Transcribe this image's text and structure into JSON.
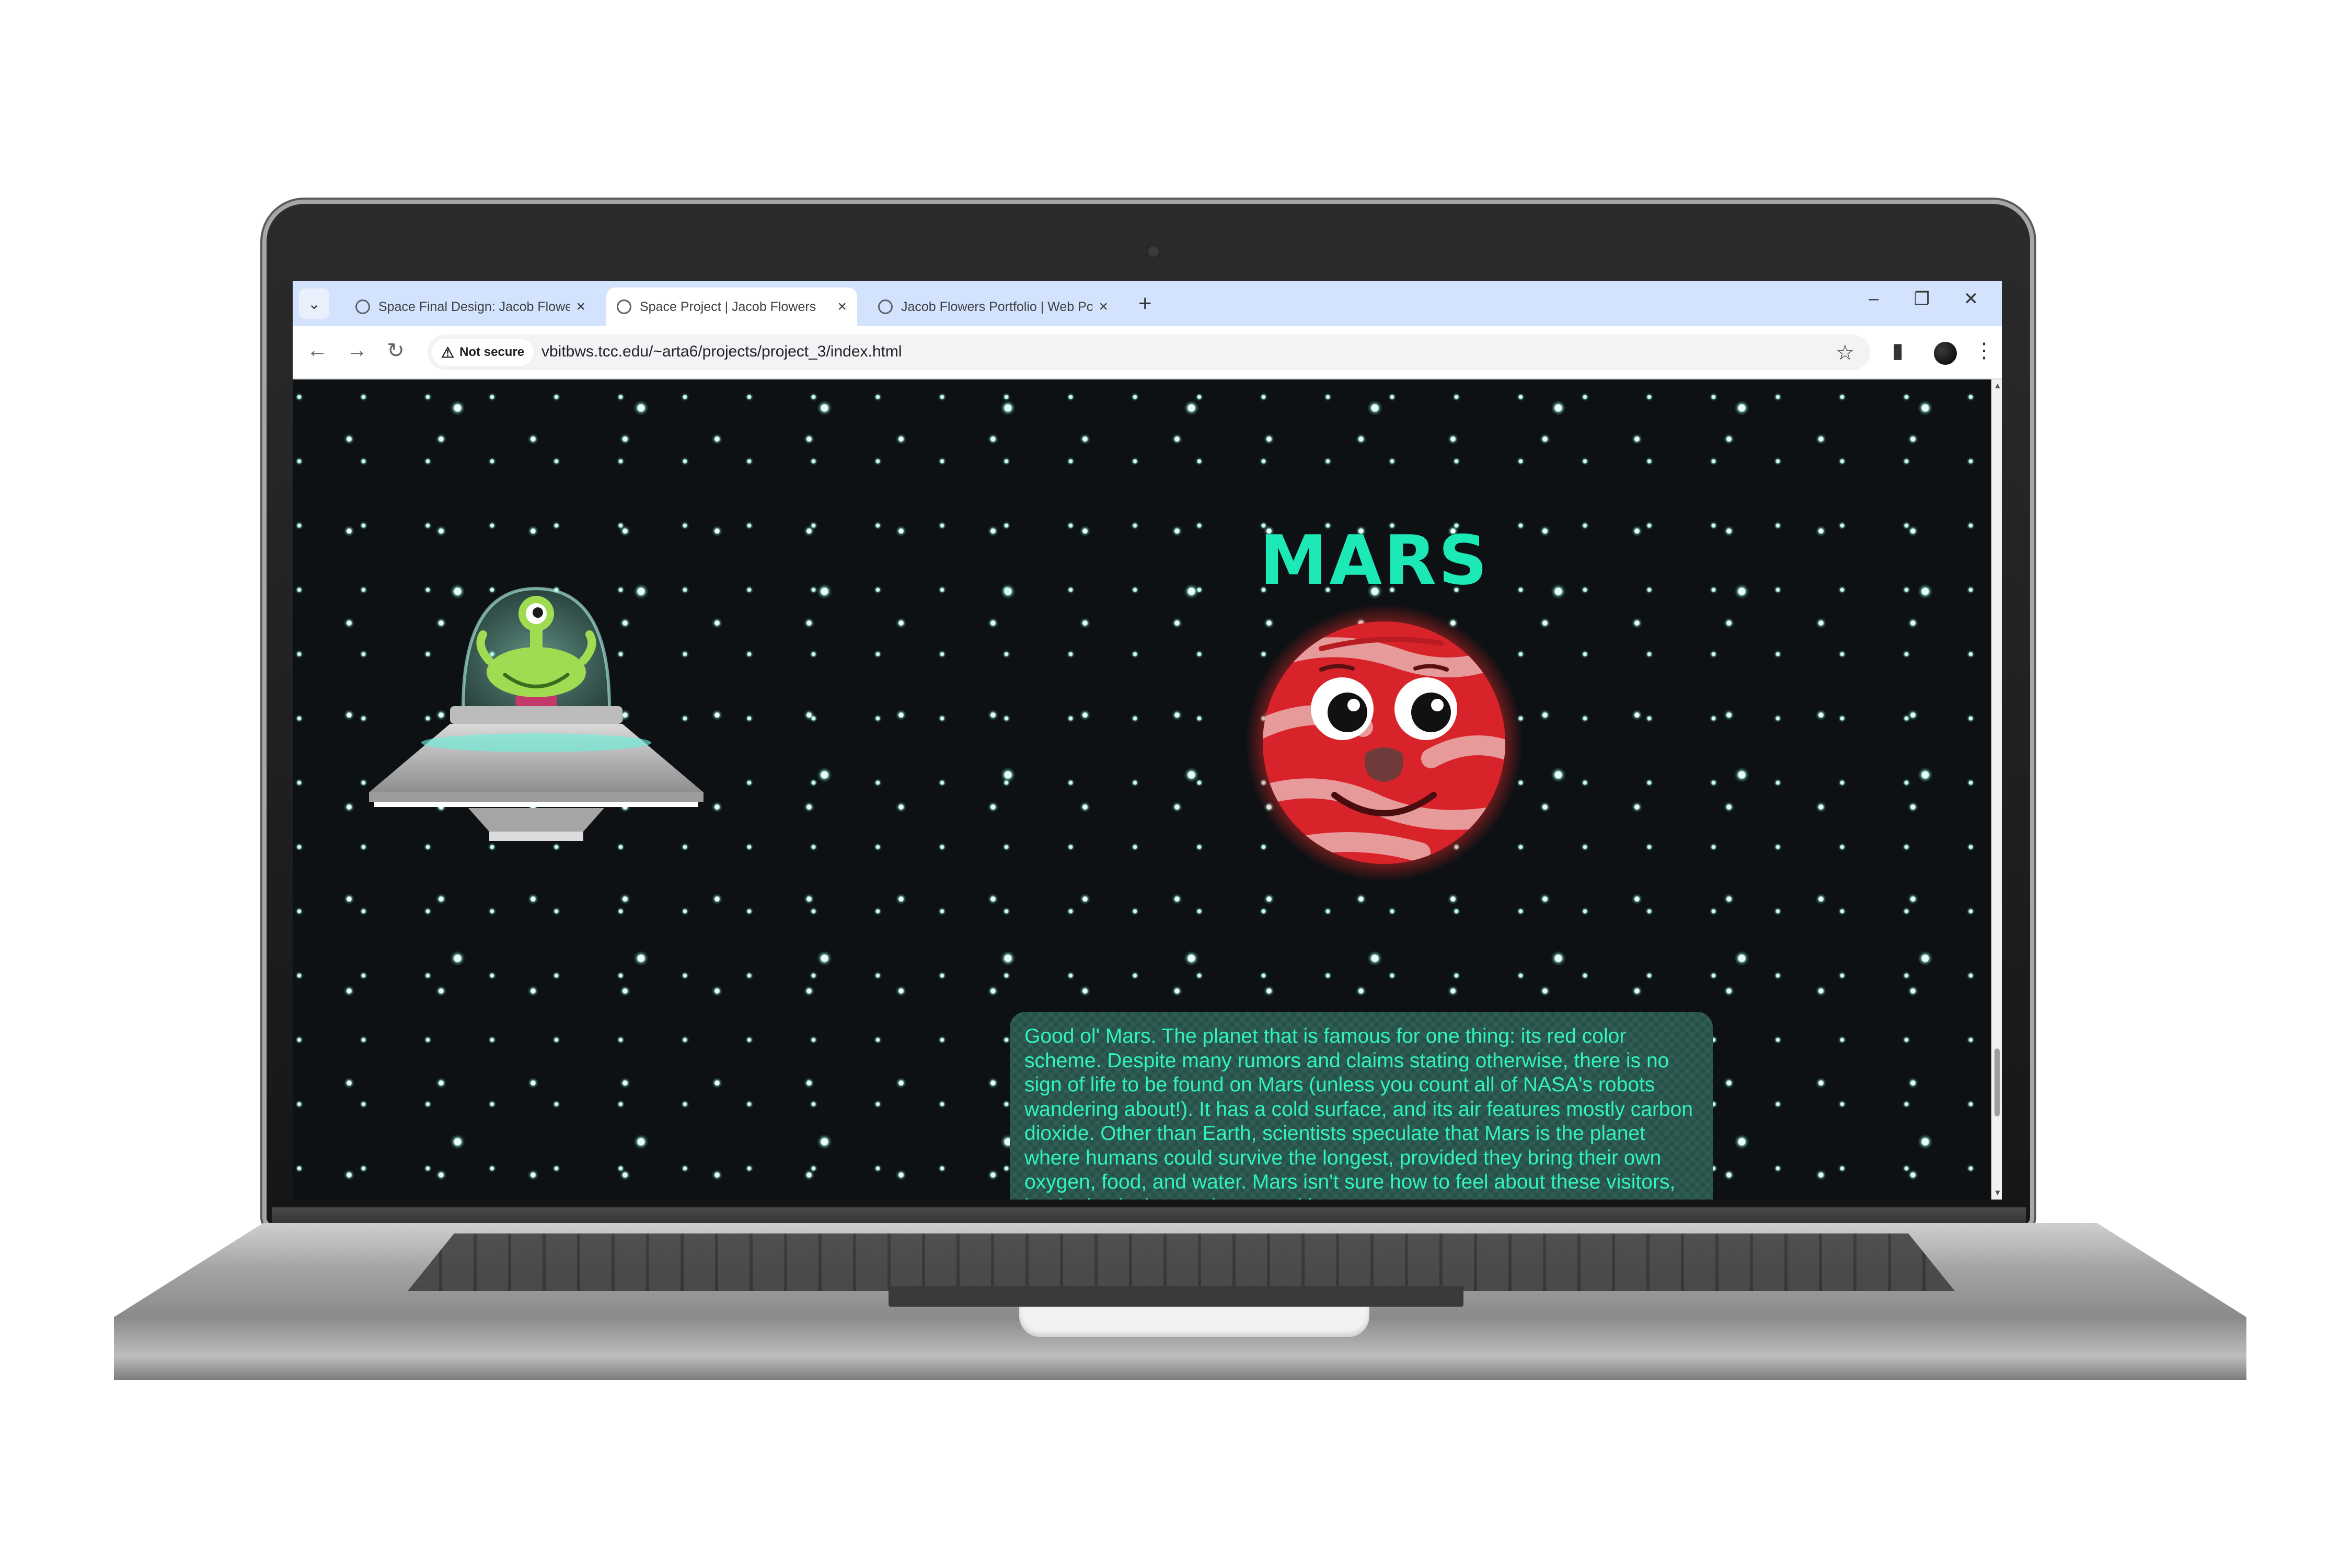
{
  "browser": {
    "tabs": [
      {
        "title": "Space Final Design: Jacob Flowers",
        "active": false
      },
      {
        "title": "Space Project | Jacob Flowers",
        "active": true
      },
      {
        "title": "Jacob Flowers Portfolio | Web Portfolio",
        "active": false
      }
    ],
    "security_label": "Not secure",
    "url": "vbitbws.tcc.edu/~arta6/projects/project_3/index.html"
  },
  "page": {
    "title": "MARS",
    "description": "Good ol' Mars. The planet that is famous for one thing: its red color scheme. Despite many rumors and claims stating otherwise, there is no sign of life to be found on Mars (unless you count all of NASA's robots wandering about!). It has a cold surface, and its air features mostly carbon dioxide. Other than Earth, scientists speculate that Mars is the planet where humans could survive the longest, provided they bring their own oxygen, food, and water. Mars isn't sure how to feel about these visitors, but it tries its best to be a good host."
  },
  "colors": {
    "accent": "#1de9b6",
    "background": "#0e1114",
    "info_box": "#245249",
    "planet_red": "#d8232a"
  },
  "icons": [
    "tab-list-icon",
    "close-icon",
    "plus-icon",
    "minimize-icon",
    "restore-icon",
    "back-icon",
    "forward-icon",
    "reload-icon",
    "warning-icon",
    "star-icon",
    "side-panel-icon",
    "menu-icon"
  ]
}
